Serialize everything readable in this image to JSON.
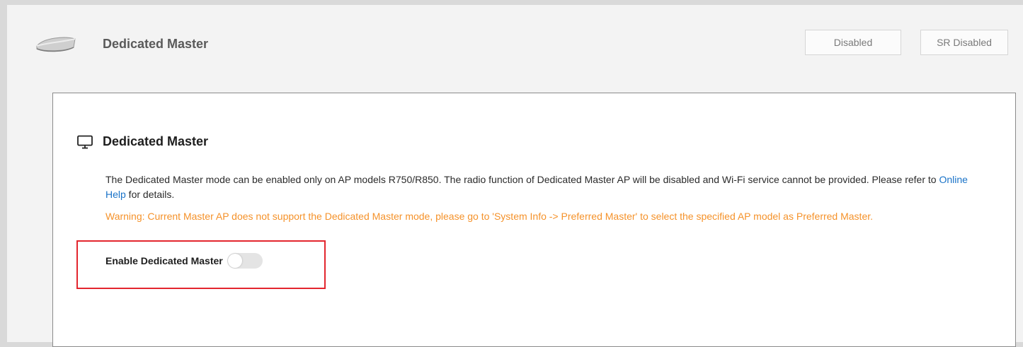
{
  "header": {
    "title": "Dedicated Master",
    "status_disabled": "Disabled",
    "status_sr_disabled": "SR Disabled"
  },
  "card": {
    "title": "Dedicated Master",
    "description_pre": "The Dedicated Master mode can be enabled only on AP models R750/R850. The radio function of Dedicated Master AP will be disabled and Wi-Fi service cannot be provided. Please refer to ",
    "help_link": "Online Help",
    "description_post": " for details.",
    "warning": "Warning: Current Master AP does not support the Dedicated Master mode, please go to 'System Info -> Preferred Master' to select the specified AP model as Preferred Master.",
    "toggle_label": "Enable Dedicated Master",
    "toggle_on": false
  },
  "colors": {
    "warning": "#f5922a",
    "link": "#1a73c8",
    "highlight": "#e3262e"
  },
  "icons": [
    "access-point-icon",
    "monitor-icon"
  ]
}
